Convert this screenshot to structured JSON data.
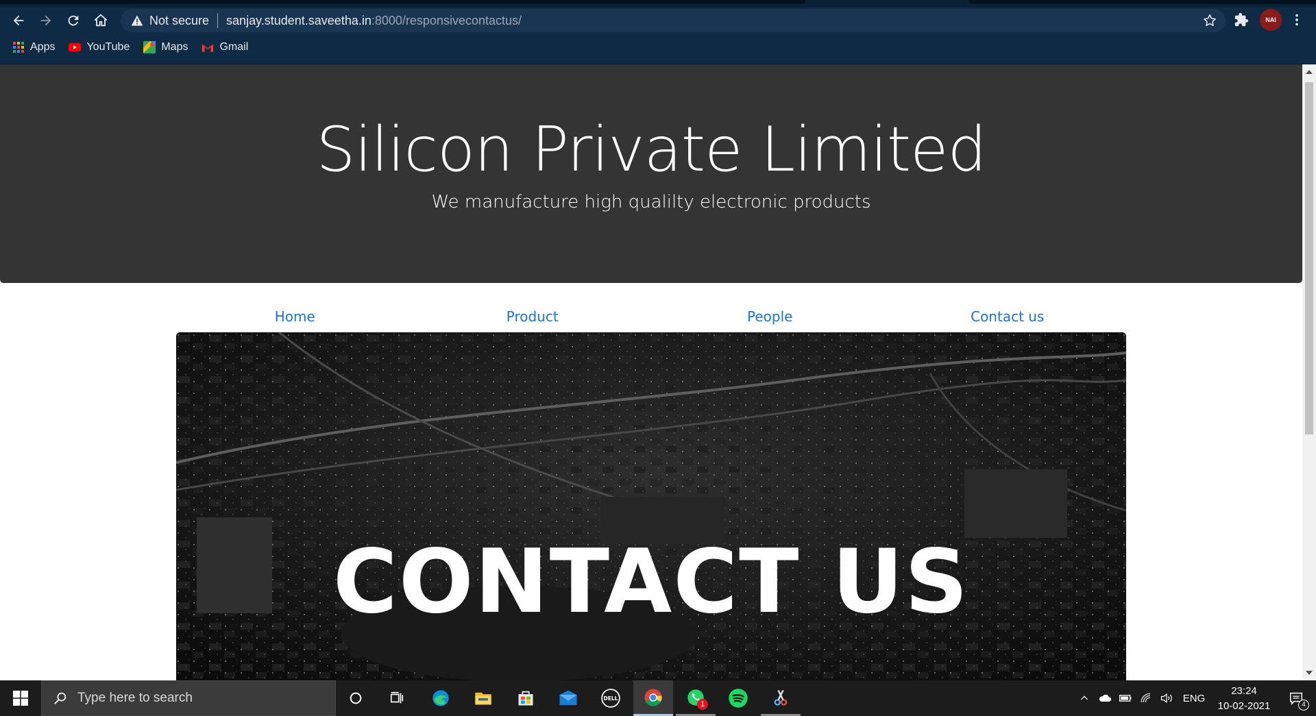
{
  "browser": {
    "security_label": "Not secure",
    "url_host": "sanjay.student.saveetha.in",
    "url_rest": ":8000/responsivecontactus/",
    "bookmarks": [
      {
        "label": "Apps",
        "icon": "apps-grid-icon"
      },
      {
        "label": "YouTube",
        "icon": "youtube-icon"
      },
      {
        "label": "Maps",
        "icon": "maps-icon"
      },
      {
        "label": "Gmail",
        "icon": "gmail-icon"
      }
    ],
    "profile_badge": "NAI"
  },
  "page": {
    "title": "Silicon Private Limited",
    "subtitle": "We manufacture high qualilty electronic products",
    "nav": [
      "Home",
      "Product",
      "People",
      "Contact us"
    ],
    "hero_text": "CONTACT US"
  },
  "taskbar": {
    "search_placeholder": "Type here to search",
    "whatsapp_badge": "1",
    "tray_language": "ENG",
    "time": "23:24",
    "date": "10-02-2021",
    "notification_count": "4"
  },
  "colors": {
    "chrome_bg": "#0e2a44",
    "jumbotron_bg": "#343434",
    "link": "#1a73d9"
  }
}
